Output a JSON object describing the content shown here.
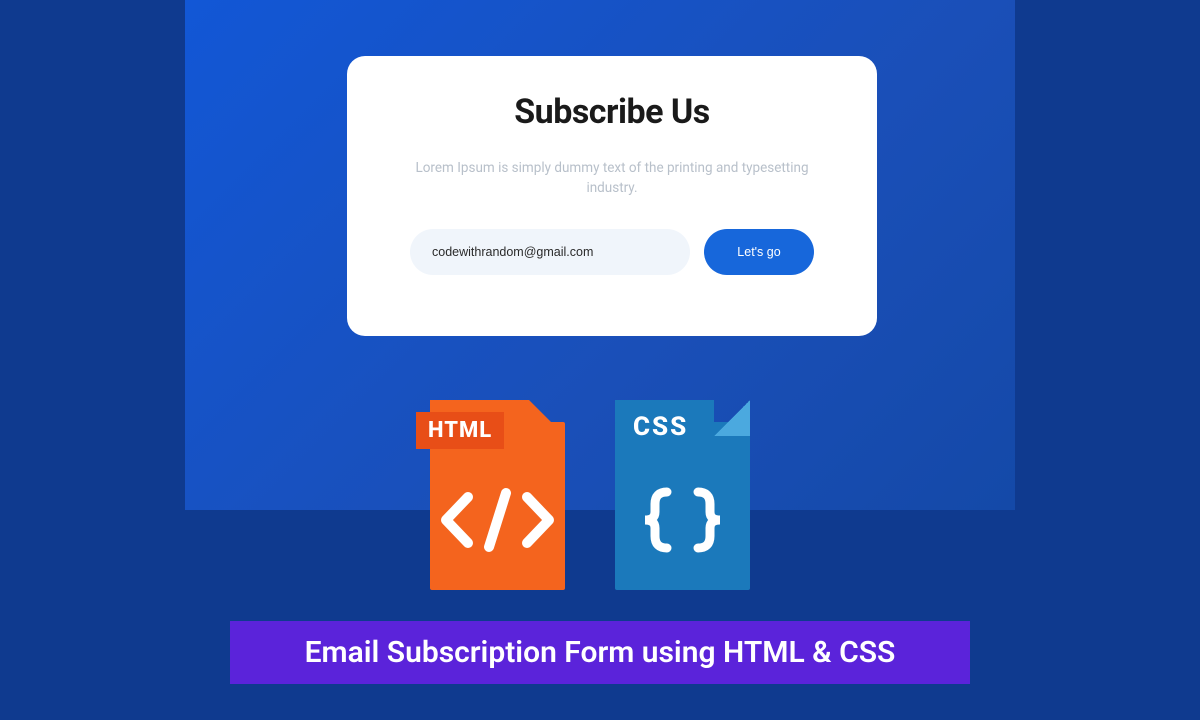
{
  "card": {
    "title": "Subscribe Us",
    "description": "Lorem Ipsum is simply dummy text of the printing and typesetting industry.",
    "email_value": "codewithrandom@gmail.com",
    "button_label": "Let's go"
  },
  "icons": {
    "html_label": "HTML",
    "html_glyph": "</>",
    "css_label": "CSS",
    "css_glyph": "{ }"
  },
  "banner": {
    "text": "Email Subscription Form using HTML & CSS"
  },
  "colors": {
    "background": "#0f3a8f",
    "panel": "#1257d6",
    "button": "#1767db",
    "html_icon": "#f4641e",
    "css_icon": "#1b79bb",
    "banner": "#5b23da"
  }
}
